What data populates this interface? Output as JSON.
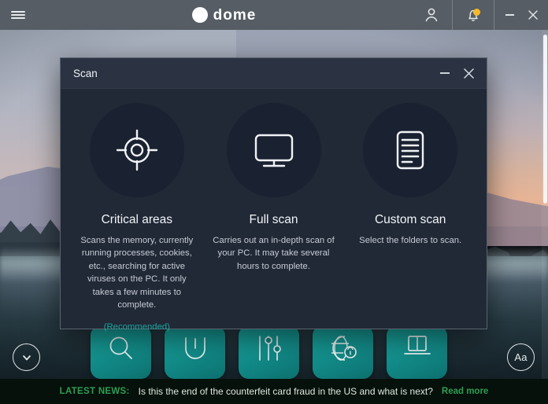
{
  "window": {
    "menu_icon": "hamburger-menu-icon",
    "brand": "dome",
    "account_icon": "user-account-icon",
    "notifications_icon": "bell-notification-icon",
    "minimize_label": "–",
    "close_label": "✕"
  },
  "dialog": {
    "title": "Scan",
    "minimize_label": "–",
    "close_label": "✕",
    "options": [
      {
        "icon": "crosshair-target-icon",
        "title": "Critical areas",
        "desc": "Scans the memory, currently running processes, cookies, etc., searching for active viruses on the PC. It only takes a few minutes to complete.",
        "recommended": "(Recommended)"
      },
      {
        "icon": "monitor-display-icon",
        "title": "Full scan",
        "desc": "Carries out an in-depth scan of your PC. It may take several hours to complete.",
        "recommended": ""
      },
      {
        "icon": "document-lines-icon",
        "title": "Custom scan",
        "desc": "Select the folders to scan.",
        "recommended": ""
      }
    ]
  },
  "toolbar": {
    "buttons": [
      {
        "icon": "magnifier-scan-icon"
      },
      {
        "icon": "power-shield-icon"
      },
      {
        "icon": "sliders-tuning-icon"
      },
      {
        "icon": "globe-lock-icon"
      },
      {
        "icon": "laptop-icon"
      }
    ],
    "scroll_down_icon": "chevron-down-icon",
    "text_size_label": "Aa"
  },
  "news": {
    "label": "LATEST NEWS:",
    "headline": "Is this the end of the counterfeit card fraud in the US and what is next?",
    "link": "Read more"
  },
  "colors": {
    "titlebar": "#565d64",
    "dialog_bg": "#212836",
    "dialog_head": "#2b3342",
    "circle_bg": "#1a2130",
    "accent_teal": "#19a79d",
    "news_green": "#2f9e52",
    "badge_orange": "#f5b92b"
  }
}
